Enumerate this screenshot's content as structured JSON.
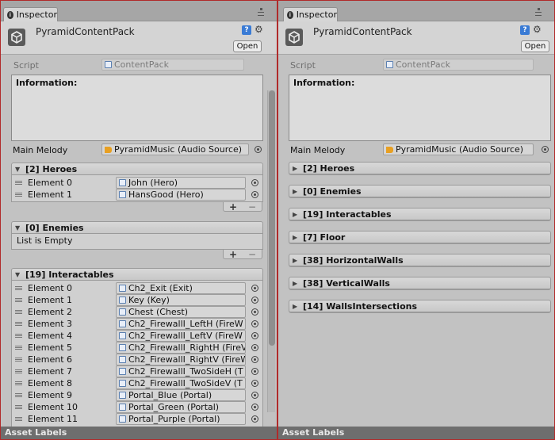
{
  "tab_label": "Inspector",
  "object_title": "PyramidContentPack",
  "open_label": "Open",
  "script": {
    "label": "Script",
    "value": "ContentPack"
  },
  "info_label": "Information:",
  "main_melody": {
    "label": "Main Melody",
    "value": "PyramidMusic (Audio Source)"
  },
  "asset_labels": "Asset Labels",
  "left": {
    "heroes": {
      "title": "[2] Heroes",
      "elements": [
        {
          "label": "Element 0",
          "value": "John (Hero)"
        },
        {
          "label": "Element 1",
          "value": "HansGood (Hero)"
        }
      ]
    },
    "enemies": {
      "title": "[0] Enemies",
      "empty_text": "List is Empty"
    },
    "interactables": {
      "title": "[19] Interactables",
      "elements": [
        {
          "label": "Element 0",
          "value": "Ch2_Exit (Exit)"
        },
        {
          "label": "Element 1",
          "value": "Key (Key)"
        },
        {
          "label": "Element 2",
          "value": "Chest (Chest)"
        },
        {
          "label": "Element 3",
          "value": "Ch2_FirewallI_LeftH (FireW"
        },
        {
          "label": "Element 4",
          "value": "Ch2_FirewallI_LeftV (FireW"
        },
        {
          "label": "Element 5",
          "value": "Ch2_FirewallI_RightH (FireV"
        },
        {
          "label": "Element 6",
          "value": "Ch2_FirewallI_RightV (FireW"
        },
        {
          "label": "Element 7",
          "value": "Ch2_FirewallI_TwoSideH (T"
        },
        {
          "label": "Element 8",
          "value": "Ch2_FirewallI_TwoSideV (T"
        },
        {
          "label": "Element 9",
          "value": "Portal_Blue (Portal)"
        },
        {
          "label": "Element 10",
          "value": "Portal_Green (Portal)"
        },
        {
          "label": "Element 11",
          "value": "Portal_Purple (Portal)"
        }
      ]
    }
  },
  "right": {
    "sections": [
      "[2] Heroes",
      "[0] Enemies",
      "[19] Interactables",
      "[7] Floor",
      "[38] HorizontalWalls",
      "[38] VerticalWalls",
      "[14] WallsIntersections"
    ]
  }
}
